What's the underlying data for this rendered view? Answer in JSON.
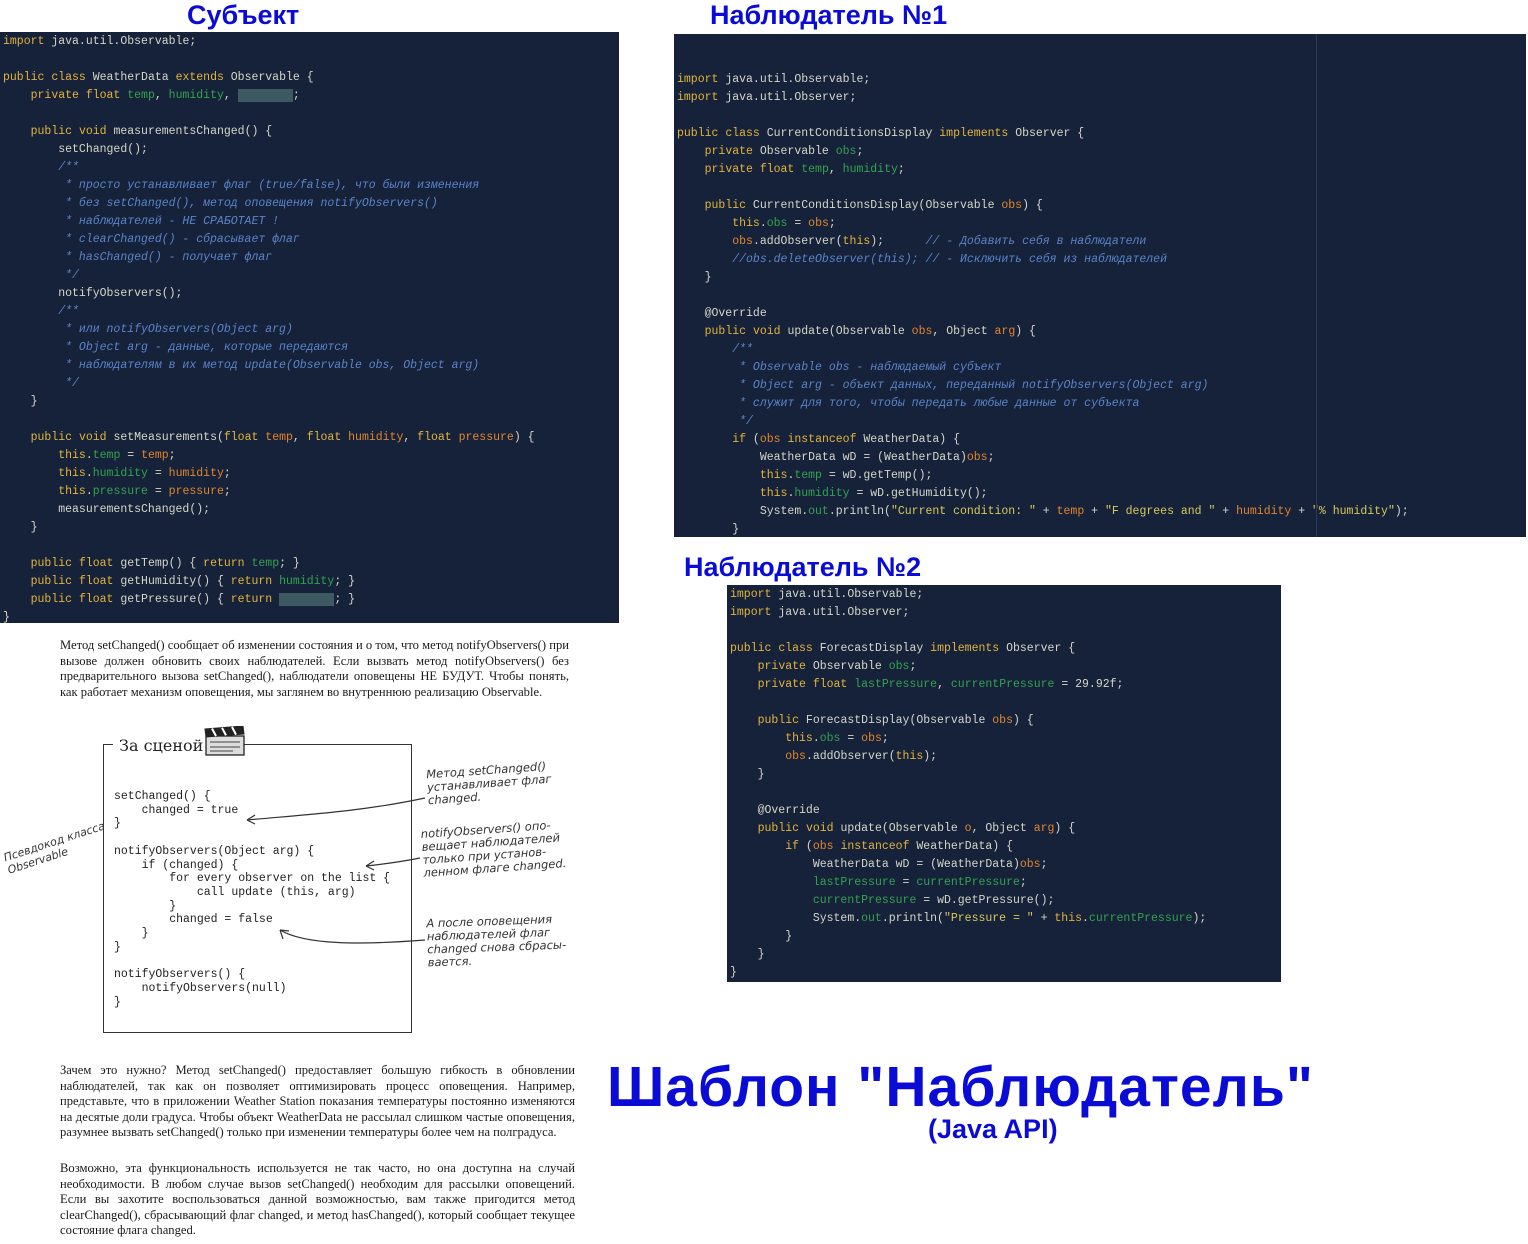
{
  "headings": {
    "subject": "Субъект",
    "observer1": "Наблюдатель №1",
    "observer2": "Наблюдатель №2",
    "main_title": "Шаблон \"Наблюдатель\"",
    "main_subtitle": "(Java API)"
  },
  "panels": {
    "subject": [
      "import java.util.Observable;",
      "",
      "public class WeatherData extends Observable {",
      "    private float temp, humidity, pressure;",
      "",
      "    public void measurementsChanged() {",
      "        setChanged();",
      "        /**",
      "         * просто устанавливает флаг (true/false), что были изменения",
      "         * без setChanged(), метод оповещения notifyObservers()",
      "         * наблюдателей - НЕ СРАБОТАЕТ !",
      "         * clearChanged() - сбрасывает флаг",
      "         * hasChanged() - получает флаг",
      "         */",
      "        notifyObservers();",
      "        /**",
      "         * или notifyObservers(Object arg)",
      "         * Object arg - данные, которые передаются",
      "         * наблюдателям в их метод update(Observable obs, Object arg)",
      "         */",
      "    }",
      "",
      "    public void setMeasurements(float temp, float humidity, float pressure) {",
      "        this.temp = temp;",
      "        this.humidity = humidity;",
      "        this.pressure = pressure;",
      "        measurementsChanged();",
      "    }",
      "",
      "    public float getTemp() { return temp; }",
      "    public float getHumidity() { return humidity; }",
      "    public float getPressure() { return pressure; }",
      "}"
    ],
    "observer1": [
      "import java.util.Observable;",
      "import java.util.Observer;",
      "",
      "public class CurrentConditionsDisplay implements Observer {",
      "    private Observable obs;",
      "    private float temp, humidity;",
      "",
      "    public CurrentConditionsDisplay(Observable obs) {",
      "        this.obs = obs;",
      "        obs.addObserver(this);      // - Добавить себя в наблюдатели",
      "        //obs.deleteObserver(this); // - Исключить себя из наблюдателей",
      "    }",
      "",
      "    @Override",
      "    public void update(Observable obs, Object arg) {",
      "        /**",
      "         * Observable obs - наблюдаемый субъект",
      "         * Object arg - объект данных, переданный notifyObservers(Object arg)",
      "         * служит для того, чтобы передать любые данные от субъекта",
      "         */",
      "        if (obs instanceof WeatherData) {",
      "            WeatherData wD = (WeatherData)obs;",
      "            this.temp = wD.getTemp();",
      "            this.humidity = wD.getHumidity();",
      "            System.out.println(\"Current condition: \" + temp + \"F degrees and \" + humidity + \"% humidity\");",
      "        }",
      "    }",
      "}"
    ],
    "observer2": [
      "import java.util.Observable;",
      "import java.util.Observer;",
      "",
      "public class ForecastDisplay implements Observer {",
      "    private Observable obs;",
      "    private float lastPressure, currentPressure = 29.92f;",
      "",
      "    public ForecastDisplay(Observable obs) {",
      "        this.obs = obs;",
      "        obs.addObserver(this);",
      "    }",
      "",
      "    @Override",
      "    public void update(Observable o, Object arg) {",
      "        if (obs instanceof WeatherData) {",
      "            WeatherData wD = (WeatherData)obs;",
      "            lastPressure = currentPressure;",
      "            currentPressure = wD.getPressure();",
      "            System.out.println(\"Pressure = \" + this.currentPressure);",
      "        }",
      "    }",
      "}"
    ]
  },
  "book": {
    "paragraph1": "Метод setChanged() сообщает об изменении состояния и о том, что метод notifyObservers() при вызове должен обновить своих наблюдателей. Если вызвать метод notifyObservers() без предварительного вызова setChanged(), наблюдатели оповещены НЕ БУДУТ. Чтобы понять, как работает механизм оповещения, мы заглянем во внутреннюю реализацию Observable.",
    "scene_title": "За сценой",
    "pseudocode": "setChanged() {\n    changed = true\n}\n\nnotifyObservers(Object arg) {\n    if (changed) {\n        for every observer on the list {\n            call update (this, arg)\n        }\n        changed = false\n    }\n}\n\nnotifyObservers() {\n    notifyObservers(null)\n}",
    "side_note": "Псевдокод класса\nObservable",
    "note1": "Метод setChanged()\nустанавливает флаг\nchanged.",
    "note2": "notifyObservers() опо-\nвещает наблюдателей\nтолько при установ-\nленном флаге changed.",
    "note3": "А после оповещения\nнаблюдателей флаг\nchanged снова сбрасы-\nвается.",
    "paragraph2": "Зачем это нужно? Метод setChanged() предоставляет большую гибкость в обновлении наблюдателей, так как он позволяет оптимизировать процесс оповещения. Например, представьте, что в приложении Weather Station показания температуры постоянно изменяются на десятые доли градуса. Чтобы объект WeatherData не рассылал слишком частые оповещения, разумнее вызвать setChanged() только при изменении температуры более чем на полградуса.",
    "paragraph3": "Возможно, эта функциональность используется не так часто, но она доступна на случай необходимости. В любом случае вызов setChanged() необходим для рассылки оповещений. Если вы захотите воспользоваться данной возможностью, вам также пригодится метод clearChanged(), сбрасывающий флаг changed, и метод hasChanged(), который сообщает текущее состояние флага changed."
  },
  "colors": {
    "heading": "#0b0bd6",
    "code_bg": "#16223a",
    "keyword": "#e2b33c",
    "field": "#33a24f",
    "param": "#e0852c",
    "comment": "#5b84c9"
  }
}
